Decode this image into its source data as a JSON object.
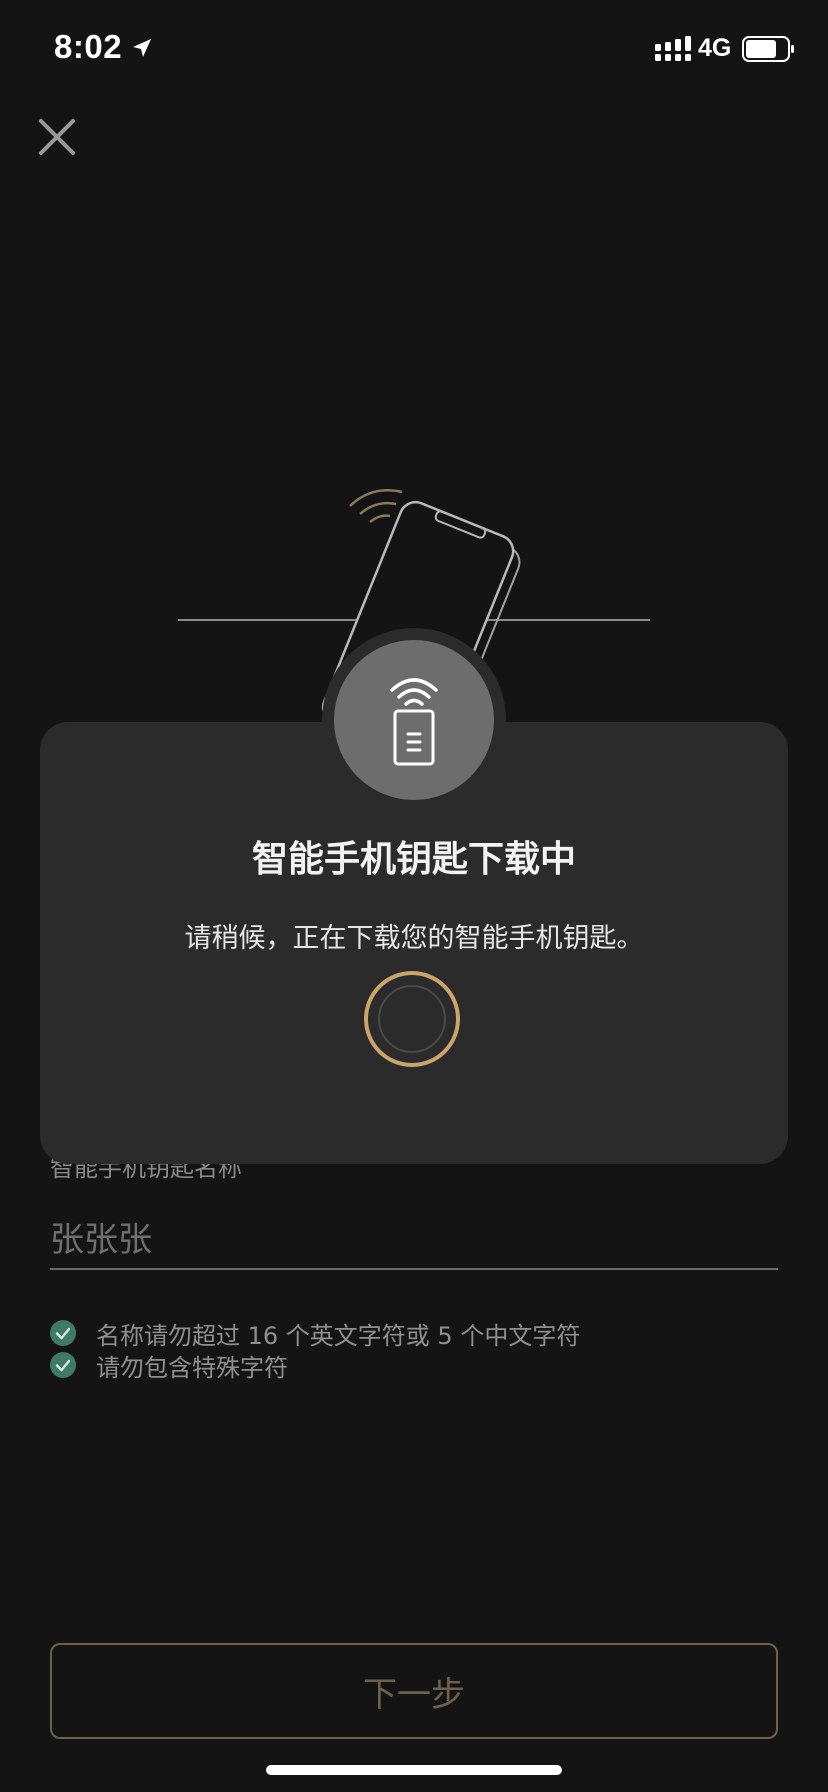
{
  "status_bar": {
    "time": "8:02",
    "network": "4G",
    "battery_level": 0.75
  },
  "form": {
    "name_label": "智能手机钥匙名称",
    "name_value": "张张张",
    "rules": [
      "名称请勿超过 16 个英文字符或 5 个中文字符",
      "请勿包含特殊字符"
    ],
    "next_button_label": "下一步"
  },
  "modal": {
    "title": "智能手机钥匙下载中",
    "description": "请稍候，正在下载您的智能手机钥匙。"
  },
  "icons": {
    "close": "close-icon",
    "phone_key": "phone-key-icon",
    "wifi": "wifi-icon",
    "check": "check-icon"
  },
  "colors": {
    "background": "#141414",
    "modal": "#2b2b2b",
    "accent_gold": "#c9a56a",
    "check_green": "#3f7a66",
    "button_border": "#6d6149"
  }
}
